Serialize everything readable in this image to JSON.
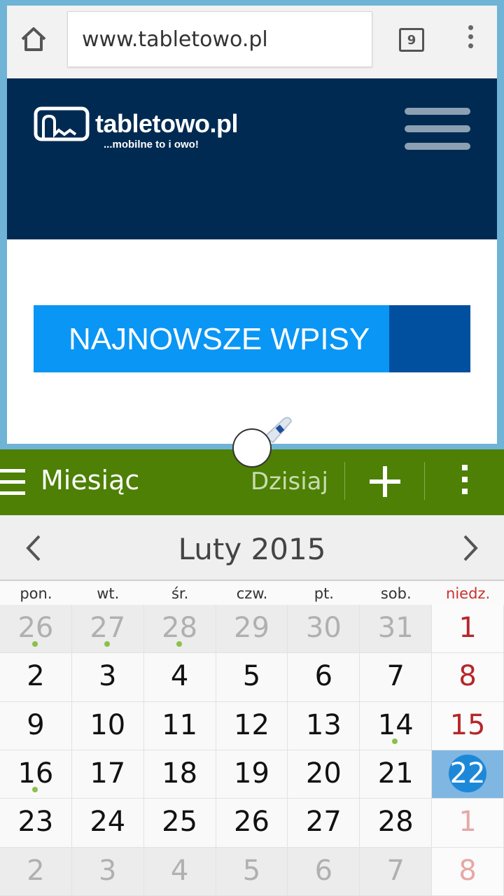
{
  "browser": {
    "url": "www.tabletowo.pl",
    "tab_count": "9",
    "site": {
      "logo_text": "tabletowo.pl",
      "tagline": "...mobilne to i owo!",
      "banner": "NAJNOWSZE WPISY"
    }
  },
  "calendar": {
    "view_title": "Miesiąc",
    "today_label": "Dzisiaj",
    "month_title": "Luty 2015",
    "weekdays": [
      "pon.",
      "wt.",
      "śr.",
      "czw.",
      "pt.",
      "sob.",
      "niedz."
    ],
    "weeks": [
      [
        "26",
        "27",
        "28",
        "29",
        "30",
        "31",
        "1"
      ],
      [
        "2",
        "3",
        "4",
        "5",
        "6",
        "7",
        "8"
      ],
      [
        "9",
        "10",
        "11",
        "12",
        "13",
        "14",
        "15"
      ],
      [
        "16",
        "17",
        "18",
        "19",
        "20",
        "21",
        "22"
      ],
      [
        "23",
        "24",
        "25",
        "26",
        "27",
        "28",
        "1"
      ],
      [
        "2",
        "3",
        "4",
        "5",
        "6",
        "7",
        "8"
      ]
    ],
    "today": "22",
    "colors": {
      "toolbar": "#4d8004",
      "today": "#1e88d8",
      "sunday": "#b5272a",
      "event_dot": "#8cc04a"
    }
  }
}
